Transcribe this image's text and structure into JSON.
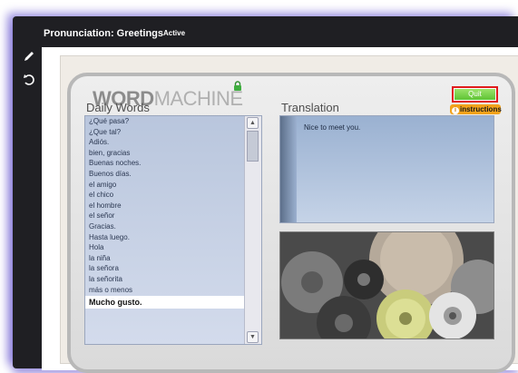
{
  "window": {
    "title": "Pronunciation: Greetings",
    "status": "Active"
  },
  "toolbar": {
    "icons": [
      "pencil-icon",
      "refresh-icon"
    ]
  },
  "app": {
    "logo_word": "WORD",
    "logo_machine": "MACHINE",
    "quit_label": "Quit",
    "instructions_label": "instructions",
    "daily_words_label": "Daily Words",
    "translation_label": "Translation",
    "translation_text": "Nice to meet you.",
    "words": [
      "¿Qué pasa?",
      "¿Que tal?",
      "Adiós.",
      "bien, gracias",
      "Buenas noches.",
      "Buenos días.",
      "el amigo",
      "el chico",
      "el hombre",
      "el señor",
      "Gracias.",
      "Hasta luego.",
      "Hola",
      "la niña",
      "la señora",
      "la señorita",
      "más o menos"
    ],
    "selected_word": "Mucho gusto.",
    "accent_color": "#f2a21b",
    "quit_color": "#5fc334"
  }
}
